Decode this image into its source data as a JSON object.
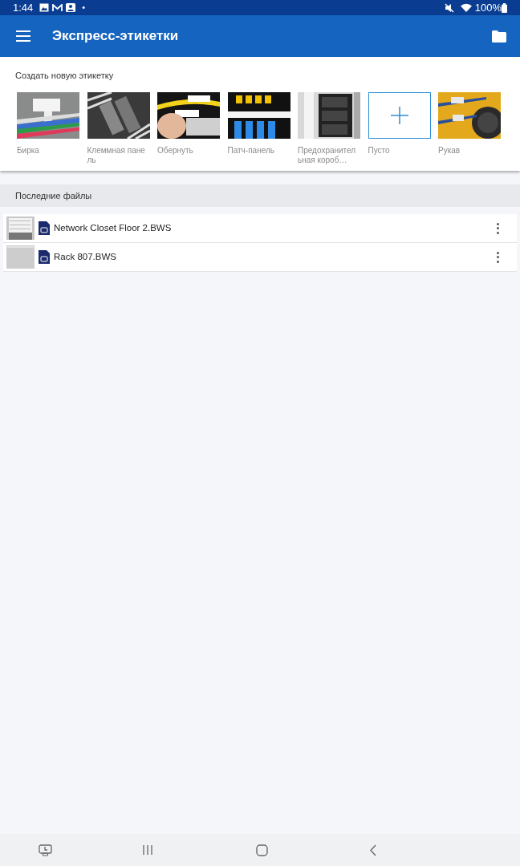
{
  "status_bar": {
    "time": "1:44",
    "dot": "•",
    "battery": "100%"
  },
  "app_bar": {
    "title": "Экспресс-этикетки"
  },
  "create_section": {
    "title": "Создать новую этикетку",
    "templates": [
      {
        "label": "Бирка",
        "kind": "picture"
      },
      {
        "label": "Клеммная панель",
        "kind": "picture"
      },
      {
        "label": "Обернуть",
        "kind": "picture"
      },
      {
        "label": "Патч-панель",
        "kind": "picture"
      },
      {
        "label": "Предохранительная короб…",
        "kind": "picture"
      },
      {
        "label": "Пусто",
        "kind": "blank"
      },
      {
        "label": "Рукав",
        "kind": "picture"
      }
    ]
  },
  "recent_section": {
    "title": "Последние файлы",
    "files": [
      {
        "name": "Network Closet Floor 2.BWS"
      },
      {
        "name": "Rack 807.BWS"
      }
    ]
  }
}
